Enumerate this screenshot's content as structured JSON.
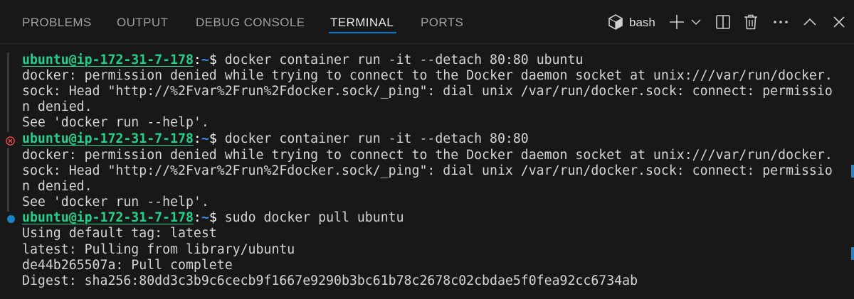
{
  "tabs": [
    {
      "label": "PROBLEMS",
      "active": false
    },
    {
      "label": "OUTPUT",
      "active": false
    },
    {
      "label": "DEBUG CONSOLE",
      "active": false
    },
    {
      "label": "TERMINAL",
      "active": true
    },
    {
      "label": "PORTS",
      "active": false
    }
  ],
  "toolbar": {
    "shell_label": "bash",
    "icons": [
      "terminal-profile-icon",
      "new-terminal-plus-icon",
      "chevron-down-icon",
      "split-terminal-icon",
      "trash-icon",
      "more-actions-icon",
      "maximize-chevron-up-icon",
      "close-icon"
    ]
  },
  "colors": {
    "background": "#181818",
    "prompt_user": "#23d18b",
    "prompt_path": "#3b8eea",
    "active_tab_underline": "#0078d4",
    "error_decoration": "#f14c4c",
    "running_decoration": "#1a85c6"
  },
  "terminal": {
    "prompt": {
      "user_host": "ubuntu@ip-172-31-7-178",
      "separator": ":",
      "path": "~",
      "symbol": "$"
    },
    "lines": [
      {
        "type": "prompt",
        "command": " docker container run -it --detach 80:80 ubuntu"
      },
      {
        "type": "output",
        "text": "docker: permission denied while trying to connect to the Docker daemon socket at unix:///var/run/docker."
      },
      {
        "type": "output",
        "text": "sock: Head \"http://%2Fvar%2Frun%2Fdocker.sock/_ping\": dial unix /var/run/docker.sock: connect: permissio"
      },
      {
        "type": "output",
        "text": "n denied."
      },
      {
        "type": "output",
        "text": "See 'docker run --help'."
      },
      {
        "type": "prompt",
        "command": " docker container run -it --detach 80:80",
        "decoration": "error"
      },
      {
        "type": "output",
        "text": "docker: permission denied while trying to connect to the Docker daemon socket at unix:///var/run/docker."
      },
      {
        "type": "output",
        "text": "sock: Head \"http://%2Fvar%2Frun%2Fdocker.sock/_ping\": dial unix /var/run/docker.sock: connect: permissio"
      },
      {
        "type": "output",
        "text": "n denied."
      },
      {
        "type": "output",
        "text": "See 'docker run --help'."
      },
      {
        "type": "prompt",
        "command": " sudo docker pull ubuntu",
        "decoration": "running"
      },
      {
        "type": "output",
        "text": "Using default tag: latest"
      },
      {
        "type": "output",
        "text": "latest: Pulling from library/ubuntu"
      },
      {
        "type": "output",
        "text": "de44b265507a: Pull complete"
      },
      {
        "type": "output",
        "text": "Digest: sha256:80dd3c3b9c6cecb9f1667e9290b3bc61b78c2678c02cbdae5f0fea92cc6734ab"
      }
    ]
  }
}
